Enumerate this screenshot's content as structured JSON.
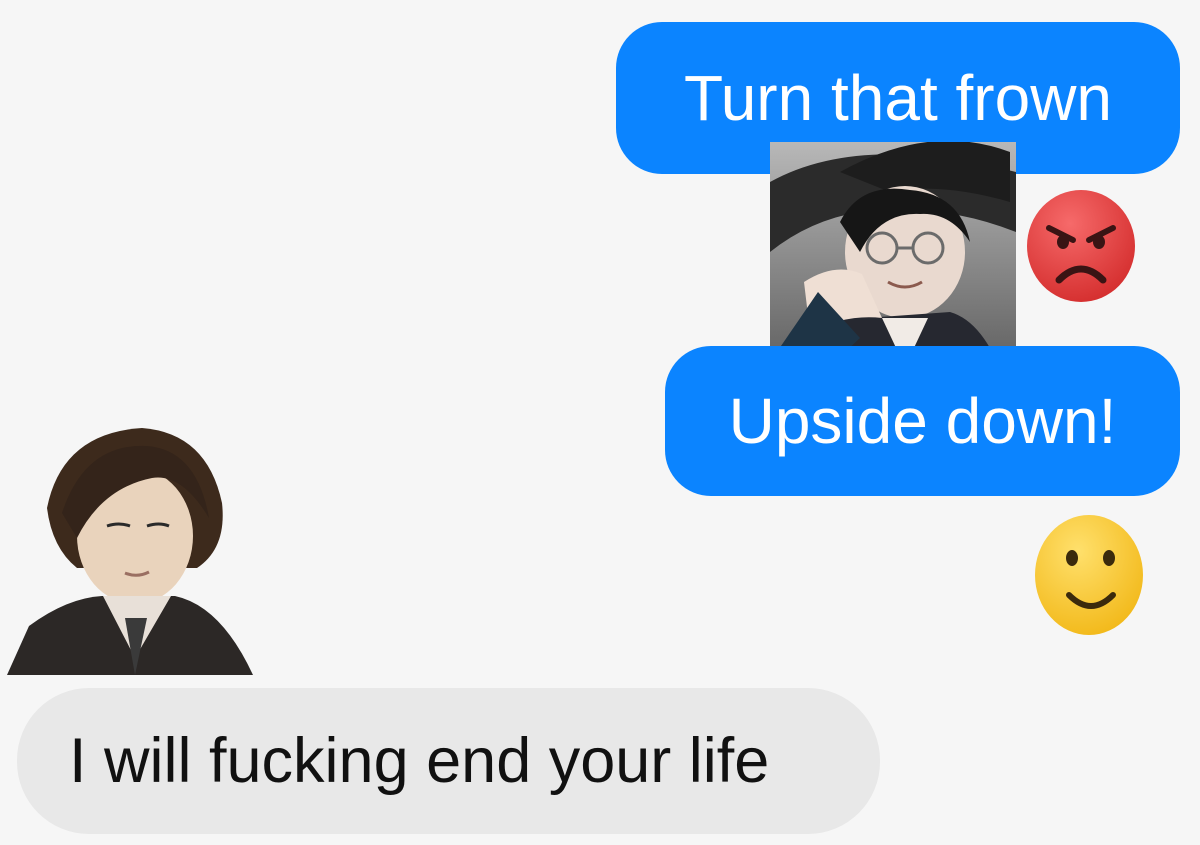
{
  "conversation": {
    "messages": [
      {
        "sender": "outgoing",
        "text": "Turn that frown"
      },
      {
        "sender": "outgoing",
        "text": "Upside down!"
      },
      {
        "sender": "incoming",
        "text": "I will fucking end your life"
      }
    ],
    "reactions": [
      {
        "icon": "angry-face-emoji",
        "color": "#e84040"
      },
      {
        "icon": "smiling-face-emoji",
        "color": "#f7c22b"
      }
    ],
    "avatars": [
      {
        "icon": "anime-character-with-hat-and-glasses"
      },
      {
        "icon": "anime-character-brown-hair"
      }
    ]
  },
  "colors": {
    "background": "#f6f6f6",
    "outgoing_bubble": "#0b84ff",
    "incoming_bubble": "#e8e8e8"
  }
}
